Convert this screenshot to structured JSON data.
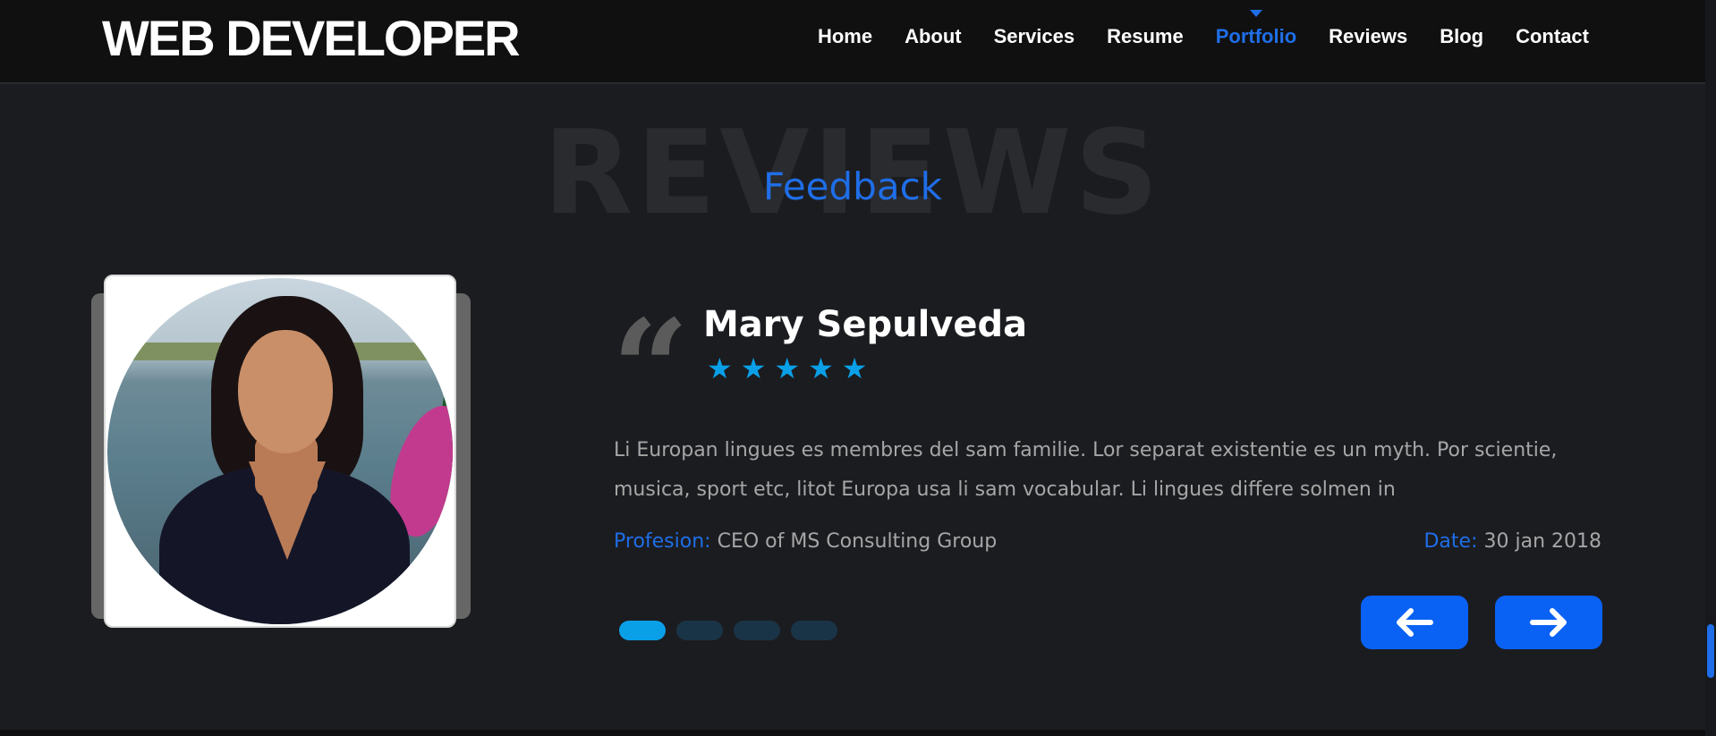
{
  "header": {
    "logo": "WEB DEVELOPER",
    "nav": [
      {
        "label": "Home"
      },
      {
        "label": "About"
      },
      {
        "label": "Services"
      },
      {
        "label": "Resume"
      },
      {
        "label": "Portfolio",
        "active": true
      },
      {
        "label": "Reviews"
      },
      {
        "label": "Blog"
      },
      {
        "label": "Contact"
      }
    ]
  },
  "section": {
    "background_title": "REVIEWS",
    "subtitle": "Feedback"
  },
  "review": {
    "name": "Mary Sepulveda",
    "rating": 5,
    "stars": [
      "★",
      "★",
      "★",
      "★",
      "★"
    ],
    "quote_glyph": "“",
    "text": "Li Europan lingues es membres del sam familie. Lor separat existentie es un myth. Por scientie, musica, sport etc, litot Europa usa li sam vocabular. Li lingues differe solmen in",
    "profession_label": "Profesion:",
    "profession_value": "CEO of MS Consulting Group",
    "date_label": "Date:",
    "date_value": "30 jan 2018"
  },
  "slider": {
    "total_slides": 4,
    "active_index": 0,
    "prev_icon": "arrow-left-icon",
    "next_icon": "arrow-right-icon"
  },
  "colors": {
    "accent_blue": "#1f6ee8",
    "star_cyan": "#0aa0e8",
    "button_blue": "#0a62f4",
    "background": "#1b1c20",
    "navbar": "#101010"
  }
}
